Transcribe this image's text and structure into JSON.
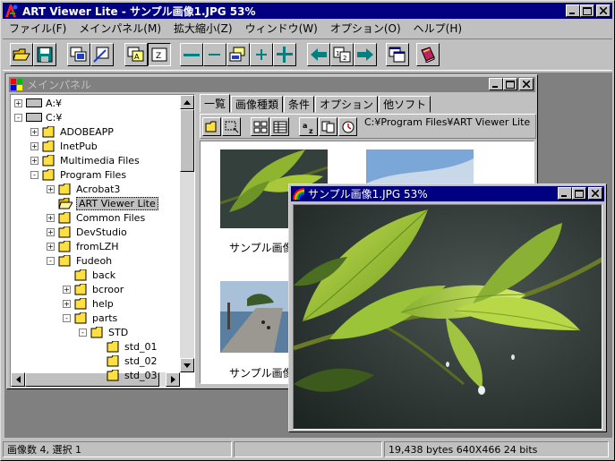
{
  "window": {
    "title": "ART Viewer Lite - サンプル画像1.JPG 53%"
  },
  "menu": {
    "items": [
      "ファイル(F)",
      "メインパネル(M)",
      "拡大縮小(Z)",
      "ウィンドウ(W)",
      "オプション(O)",
      "ヘルプ(H)"
    ]
  },
  "toolbar": {
    "icons": [
      "open-folder-icon",
      "save-icon",
      "thumbnail-view-icon",
      "edit-icon",
      "zoom-fit-icon",
      "zoom-window-icon",
      "zoom-out-icon",
      "zoom-out-small-icon",
      "zoom-copy-icon",
      "zoom-in-small-icon",
      "zoom-in-icon",
      "prev-arrow-icon",
      "page-icon",
      "next-arrow-icon",
      "window-icon",
      "book-icon"
    ]
  },
  "main_panel": {
    "title": "メインパネル",
    "tree": [
      {
        "label": "A:¥",
        "level": 0,
        "kind": "drive",
        "pm": "+"
      },
      {
        "label": "C:¥",
        "level": 0,
        "kind": "drive",
        "pm": "-"
      },
      {
        "label": "ADOBEAPP",
        "level": 1,
        "kind": "folder",
        "pm": "+"
      },
      {
        "label": "InetPub",
        "level": 1,
        "kind": "folder",
        "pm": "+"
      },
      {
        "label": "Multimedia Files",
        "level": 1,
        "kind": "folder",
        "pm": "+"
      },
      {
        "label": "Program Files",
        "level": 1,
        "kind": "folder",
        "pm": "-"
      },
      {
        "label": "Acrobat3",
        "level": 2,
        "kind": "folder",
        "pm": "+"
      },
      {
        "label": "ART Viewer Lite",
        "level": 2,
        "kind": "folder-open",
        "pm": "",
        "selected": true
      },
      {
        "label": "Common Files",
        "level": 2,
        "kind": "folder",
        "pm": "+"
      },
      {
        "label": "DevStudio",
        "level": 2,
        "kind": "folder",
        "pm": "+"
      },
      {
        "label": "fromLZH",
        "level": 2,
        "kind": "folder",
        "pm": "+"
      },
      {
        "label": "Fudeoh",
        "level": 2,
        "kind": "folder",
        "pm": "-"
      },
      {
        "label": "back",
        "level": 3,
        "kind": "folder",
        "pm": ""
      },
      {
        "label": "bcroor",
        "level": 3,
        "kind": "folder",
        "pm": "+"
      },
      {
        "label": "help",
        "level": 3,
        "kind": "folder",
        "pm": "+"
      },
      {
        "label": "parts",
        "level": 3,
        "kind": "folder",
        "pm": "-"
      },
      {
        "label": "STD",
        "level": 4,
        "kind": "folder",
        "pm": "-"
      },
      {
        "label": "std_01",
        "level": 5,
        "kind": "folder",
        "pm": ""
      },
      {
        "label": "std_02",
        "level": 5,
        "kind": "folder",
        "pm": ""
      },
      {
        "label": "std_03",
        "level": 5,
        "kind": "folder",
        "pm": ""
      }
    ],
    "tabs": [
      "一覧",
      "画像種類",
      "条件",
      "オプション",
      "他ソフト"
    ],
    "path": "C:¥Program Files¥ART Viewer Lite",
    "thumbnails": [
      {
        "label": "サンプル画像"
      },
      {
        "label": "サンプル画像"
      }
    ]
  },
  "image_window": {
    "title": "サンプル画像1.JPG 53%"
  },
  "status": {
    "count": "画像数 4, 選択 1",
    "blank": "",
    "info": "19,438 bytes  640X466  24 bits"
  }
}
